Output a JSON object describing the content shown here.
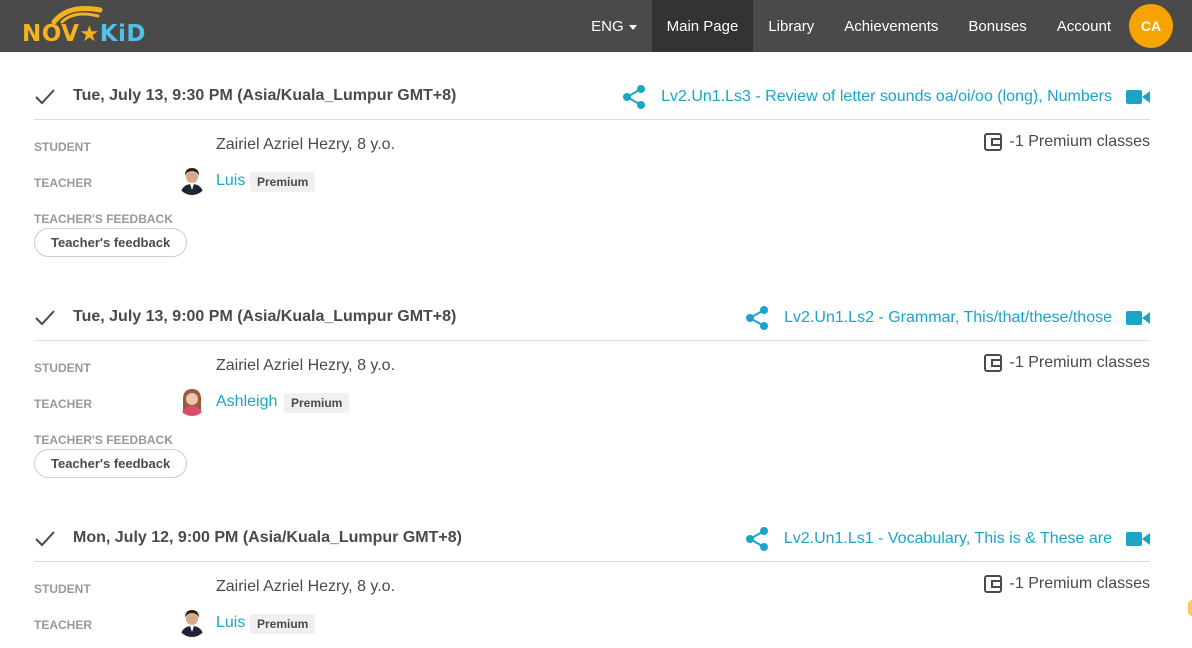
{
  "header": {
    "logo": {
      "text_a": "NOV",
      "text_b": "KiD"
    },
    "language": "ENG",
    "nav": [
      {
        "label": "Main Page",
        "active": true
      },
      {
        "label": "Library",
        "active": false
      },
      {
        "label": "Achievements",
        "active": false
      },
      {
        "label": "Bonuses",
        "active": false
      },
      {
        "label": "Account",
        "active": false
      }
    ],
    "avatar_initials": "CA"
  },
  "labels": {
    "student": "STUDENT",
    "teacher": "TEACHER",
    "teacher_feedback": "TEACHER'S FEEDBACK",
    "feedback_button": "Teacher's feedback"
  },
  "colors": {
    "accent": "#1aa4c8",
    "brand_orange": "#f7a400",
    "topbar": "#4a4a4a"
  },
  "lessons": [
    {
      "datetime": "Tue, July 13, 9:30 PM (Asia/Kuala_Lumpur GMT+8)",
      "title": "Lv2.Un1.Ls3 - Review of letter sounds oa/oi/oo (long), Numbers",
      "student": "Zairiel Azriel Hezry, 8 y.o.",
      "teacher": "Luis",
      "plan": "Premium",
      "balance": "-1 Premium classes",
      "teacher_avatar": "male"
    },
    {
      "datetime": "Tue, July 13, 9:00 PM (Asia/Kuala_Lumpur GMT+8)",
      "title": "Lv2.Un1.Ls2 - Grammar, This/that/these/those",
      "student": "Zairiel Azriel Hezry, 8 y.o.",
      "teacher": "Ashleigh",
      "plan": "Premium",
      "balance": "-1 Premium classes",
      "teacher_avatar": "female"
    },
    {
      "datetime": "Mon, July 12, 9:00 PM (Asia/Kuala_Lumpur GMT+8)",
      "title": "Lv2.Un1.Ls1 - Vocabulary, This is & These are",
      "student": "Zairiel Azriel Hezry, 8 y.o.",
      "teacher": "Luis",
      "plan": "Premium",
      "balance": "-1 Premium classes",
      "teacher_avatar": "male"
    }
  ]
}
